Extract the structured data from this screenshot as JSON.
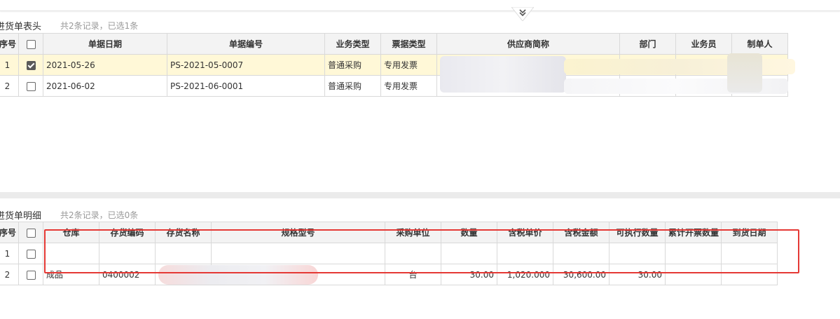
{
  "header_section": {
    "title": "进货单表头",
    "count": "共2条记录，已选1条",
    "columns": [
      "序号",
      "",
      "单据日期",
      "单据编号",
      "业务类型",
      "票据类型",
      "供应商简称",
      "部门",
      "业务员",
      "制单人"
    ],
    "rows": [
      {
        "seq": "1",
        "checked": true,
        "date": "2021-05-26",
        "code": "PS-2021-05-0007",
        "biz_type": "普通采购",
        "invoice_type": "专用发票",
        "supplier": "",
        "dept": "",
        "clerk": "",
        "maker": ""
      },
      {
        "seq": "2",
        "checked": false,
        "date": "2021-06-02",
        "code": "PS-2021-06-0001",
        "biz_type": "普通采购",
        "invoice_type": "专用发票",
        "supplier": "",
        "dept": "",
        "clerk": "",
        "maker": ""
      }
    ]
  },
  "detail_section": {
    "title": "进货单明细",
    "count": "共2条记录，已选0条",
    "columns": [
      "序号",
      "",
      "仓库",
      "存货编码",
      "存货名称",
      "规格型号",
      "采购单位",
      "数量",
      "含税单价",
      "含税金额",
      "可执行数量",
      "累计开票数量",
      "到货日期"
    ],
    "rows": [
      {
        "seq": "1",
        "checked": false,
        "warehouse": "",
        "item_code": "",
        "item_name": "",
        "spec": "",
        "unit": "",
        "qty": "",
        "unit_price": "",
        "amount": "",
        "exec_qty": "",
        "invoiced_qty": "",
        "arrival_date": ""
      },
      {
        "seq": "2",
        "checked": false,
        "warehouse": "成品",
        "item_code": "0400002",
        "item_name": "",
        "spec": "",
        "unit": "台",
        "qty": "30.00",
        "unit_price": "1,020.000",
        "amount": "30,600.00",
        "exec_qty": "30.00",
        "invoiced_qty": "",
        "arrival_date": ""
      }
    ]
  },
  "colors": {
    "selected_row": "#fff8d7",
    "highlight_box": "#e53935",
    "header_bg": "#f3f3f3"
  },
  "icons": {
    "collapse": "double-chevron-down-icon"
  }
}
